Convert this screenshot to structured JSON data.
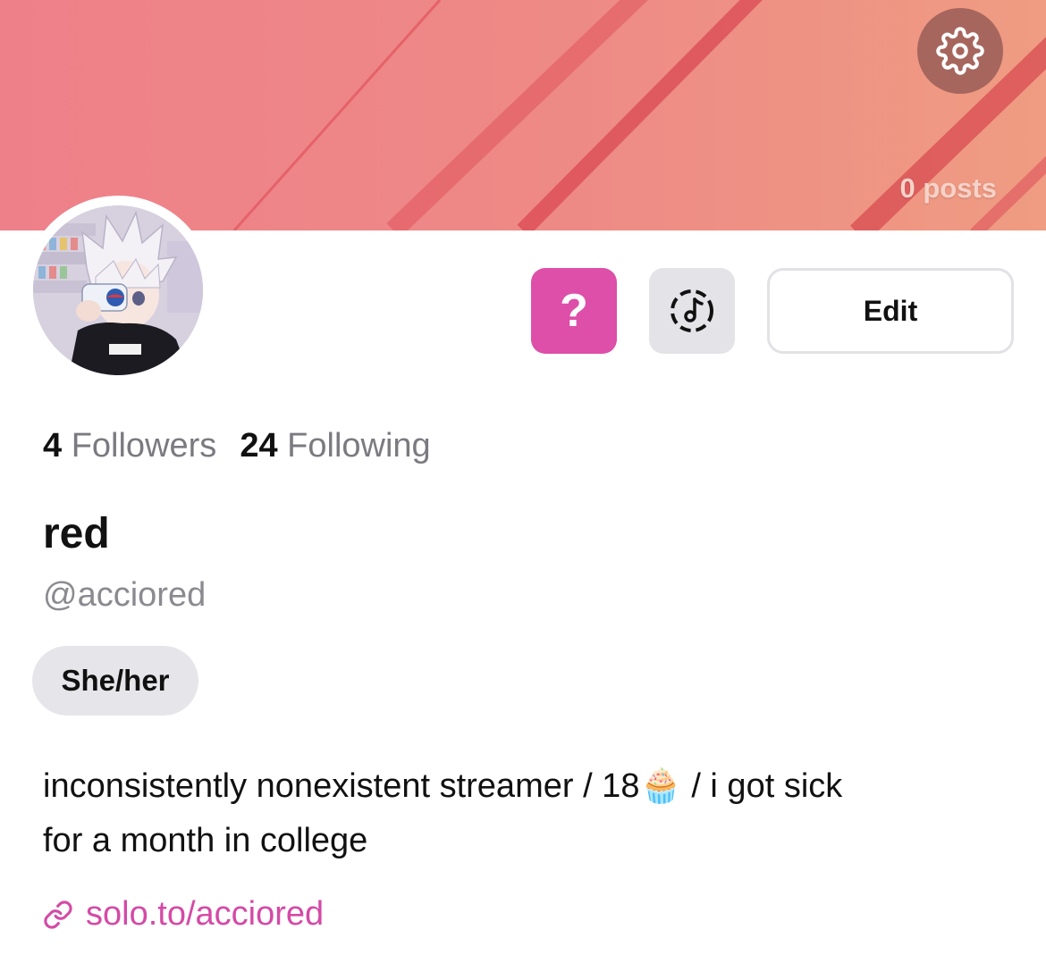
{
  "banner": {
    "posts_label": "0 posts"
  },
  "actions": {
    "ask_label": "?",
    "edit_label": "Edit"
  },
  "stats": {
    "followers_count": "4",
    "followers_label": "Followers",
    "following_count": "24",
    "following_label": "Following"
  },
  "profile": {
    "display_name": "red",
    "handle": "@acciored",
    "pronouns": "She/her",
    "bio_line1": "inconsistently nonexistent streamer / 18🧁 / i got sick",
    "bio_line2": "for a month in college",
    "link": "solo.to/acciored"
  },
  "icons": {
    "settings": "gear-icon",
    "music": "music-note-icon",
    "link": "link-icon"
  },
  "colors": {
    "banner": "#ee8089",
    "accent_pink": "#dd4fa8",
    "link": "#d44aa6",
    "settings_bg": "#a6665e"
  }
}
